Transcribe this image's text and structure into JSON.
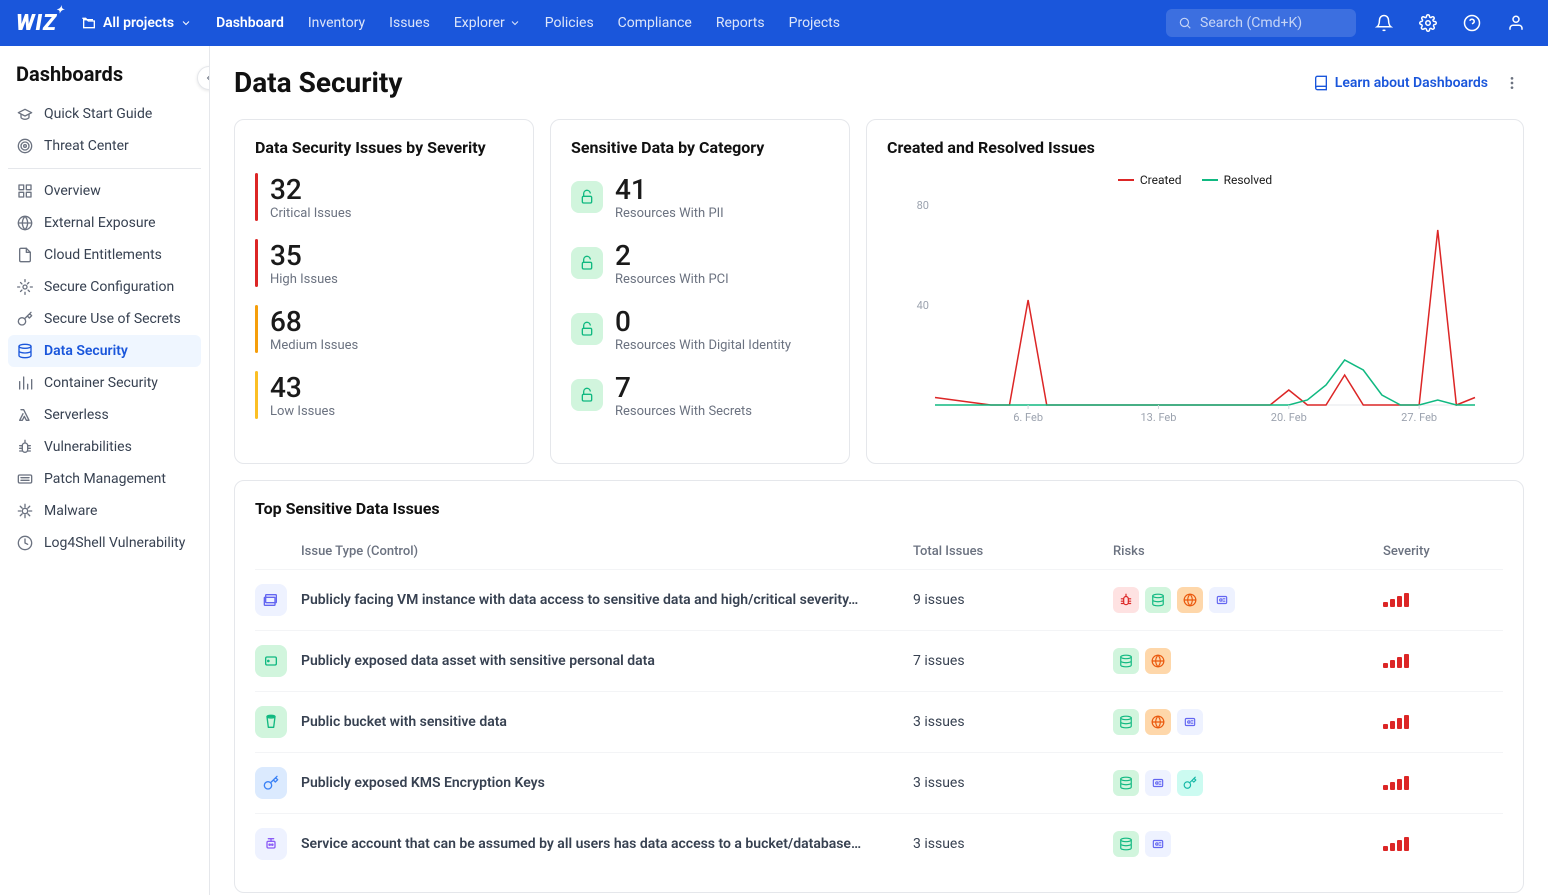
{
  "topbar": {
    "logo": "WIZ",
    "project_selector": "All projects",
    "nav": [
      {
        "label": "Dashboard",
        "active": true
      },
      {
        "label": "Inventory"
      },
      {
        "label": "Issues"
      },
      {
        "label": "Explorer",
        "dropdown": true
      },
      {
        "label": "Policies"
      },
      {
        "label": "Compliance"
      },
      {
        "label": "Reports"
      },
      {
        "label": "Projects"
      }
    ],
    "search_placeholder": "Search (Cmd+K)"
  },
  "sidebar": {
    "title": "Dashboards",
    "group1": [
      {
        "icon": "grad-cap",
        "label": "Quick Start Guide"
      },
      {
        "icon": "target",
        "label": "Threat Center"
      }
    ],
    "group2": [
      {
        "icon": "grid",
        "label": "Overview"
      },
      {
        "icon": "globe",
        "label": "External Exposure"
      },
      {
        "icon": "doc",
        "label": "Cloud Entitlements"
      },
      {
        "icon": "gear",
        "label": "Secure Configuration"
      },
      {
        "icon": "key",
        "label": "Secure Use of Secrets"
      },
      {
        "icon": "db",
        "label": "Data Security",
        "active": true
      },
      {
        "icon": "bars",
        "label": "Container Security"
      },
      {
        "icon": "lambda",
        "label": "Serverless"
      },
      {
        "icon": "bug",
        "label": "Vulnerabilities"
      },
      {
        "icon": "patch",
        "label": "Patch Management"
      },
      {
        "icon": "virus",
        "label": "Malware"
      },
      {
        "icon": "log4j",
        "label": "Log4Shell Vulnerability"
      }
    ]
  },
  "page": {
    "title": "Data Security",
    "learn_link": "Learn about Dashboards"
  },
  "severity_card": {
    "title": "Data Security Issues by Severity",
    "items": [
      {
        "value": "32",
        "label": "Critical Issues",
        "level": "crit"
      },
      {
        "value": "35",
        "label": "High Issues",
        "level": "high"
      },
      {
        "value": "68",
        "label": "Medium Issues",
        "level": "med"
      },
      {
        "value": "43",
        "label": "Low Issues",
        "level": "low"
      }
    ]
  },
  "category_card": {
    "title": "Sensitive Data by Category",
    "items": [
      {
        "value": "41",
        "label": "Resources With PII"
      },
      {
        "value": "2",
        "label": "Resources With PCI"
      },
      {
        "value": "0",
        "label": "Resources With Digital Identity"
      },
      {
        "value": "7",
        "label": "Resources With Secrets"
      }
    ]
  },
  "chart_card": {
    "title": "Created and Resolved Issues",
    "legend": [
      {
        "name": "Created",
        "color": "#dc2626"
      },
      {
        "name": "Resolved",
        "color": "#10b981"
      }
    ],
    "ylabels": [
      "80",
      "40"
    ],
    "xlabels": [
      "6. Feb",
      "13. Feb",
      "20. Feb",
      "27. Feb"
    ]
  },
  "chart_data": {
    "type": "line",
    "title": "Created and Resolved Issues",
    "xlabel": "",
    "ylabel": "",
    "ylim": [
      0,
      80
    ],
    "x_ticks": [
      "6. Feb",
      "13. Feb",
      "20. Feb",
      "27. Feb"
    ],
    "series": [
      {
        "name": "Created",
        "color": "#dc2626",
        "x": [
          0,
          1,
          2,
          3,
          4,
          5,
          6,
          7,
          8,
          9,
          10,
          11,
          12,
          13,
          14,
          15,
          16,
          17,
          18,
          19,
          20,
          21,
          22,
          23,
          24,
          25,
          26,
          27,
          28,
          29
        ],
        "values": [
          3,
          2,
          1,
          0,
          0,
          42,
          0,
          0,
          0,
          0,
          0,
          0,
          0,
          0,
          0,
          0,
          0,
          0,
          0,
          6,
          0,
          0,
          12,
          0,
          0,
          0,
          0,
          70,
          0,
          3
        ]
      },
      {
        "name": "Resolved",
        "color": "#10b981",
        "x": [
          0,
          1,
          2,
          3,
          4,
          5,
          6,
          7,
          8,
          9,
          10,
          11,
          12,
          13,
          14,
          15,
          16,
          17,
          18,
          19,
          20,
          21,
          22,
          23,
          24,
          25,
          26,
          27,
          28,
          29
        ],
        "values": [
          0,
          0,
          0,
          0,
          0,
          0,
          0,
          0,
          0,
          0,
          0,
          0,
          0,
          0,
          0,
          0,
          0,
          0,
          0,
          0,
          2,
          8,
          18,
          14,
          4,
          0,
          0,
          2,
          0,
          0
        ]
      }
    ]
  },
  "issues_table": {
    "title": "Top Sensitive Data Issues",
    "headers": {
      "name": "Issue Type (Control)",
      "total": "Total Issues",
      "risks": "Risks",
      "severity": "Severity"
    },
    "rows": [
      {
        "icon": "vm",
        "icon_bg": "#eef2ff",
        "icon_color": "#6366f1",
        "name": "Publicly facing VM instance with data access to sensitive data and high/critical severity…",
        "total": "9 issues",
        "risks": [
          {
            "icon": "bug",
            "bg": "#fee2e2",
            "color": "#dc2626"
          },
          {
            "icon": "db",
            "bg": "#d1f5dd",
            "color": "#10b981"
          },
          {
            "icon": "globe",
            "bg": "#fed7aa",
            "color": "#ea580c"
          },
          {
            "icon": "id",
            "bg": "#eef2ff",
            "color": "#6366f1"
          }
        ]
      },
      {
        "icon": "disk",
        "icon_bg": "#d1f5dd",
        "icon_color": "#10b981",
        "name": "Publicly exposed data asset with sensitive personal data",
        "total": "7 issues",
        "risks": [
          {
            "icon": "db",
            "bg": "#d1f5dd",
            "color": "#10b981"
          },
          {
            "icon": "globe",
            "bg": "#fed7aa",
            "color": "#ea580c"
          }
        ]
      },
      {
        "icon": "bucket",
        "icon_bg": "#d1f5dd",
        "icon_color": "#10b981",
        "name": "Public bucket with sensitive data",
        "total": "3 issues",
        "risks": [
          {
            "icon": "db",
            "bg": "#d1f5dd",
            "color": "#10b981"
          },
          {
            "icon": "globe",
            "bg": "#fed7aa",
            "color": "#ea580c"
          },
          {
            "icon": "id",
            "bg": "#eef2ff",
            "color": "#6366f1"
          }
        ]
      },
      {
        "icon": "key",
        "icon_bg": "#dbeafe",
        "icon_color": "#3b82f6",
        "name": "Publicly exposed KMS Encryption Keys",
        "total": "3 issues",
        "risks": [
          {
            "icon": "db",
            "bg": "#d1f5dd",
            "color": "#10b981"
          },
          {
            "icon": "id",
            "bg": "#eef2ff",
            "color": "#6366f1"
          },
          {
            "icon": "key",
            "bg": "#ccfbf1",
            "color": "#14b8a6"
          }
        ]
      },
      {
        "icon": "robot",
        "icon_bg": "#eef2ff",
        "icon_color": "#8b5cf6",
        "name": "Service account that can be assumed by all users has data access to a bucket/database…",
        "total": "3 issues",
        "risks": [
          {
            "icon": "db",
            "bg": "#d1f5dd",
            "color": "#10b981"
          },
          {
            "icon": "id",
            "bg": "#eef2ff",
            "color": "#6366f1"
          }
        ]
      }
    ]
  }
}
